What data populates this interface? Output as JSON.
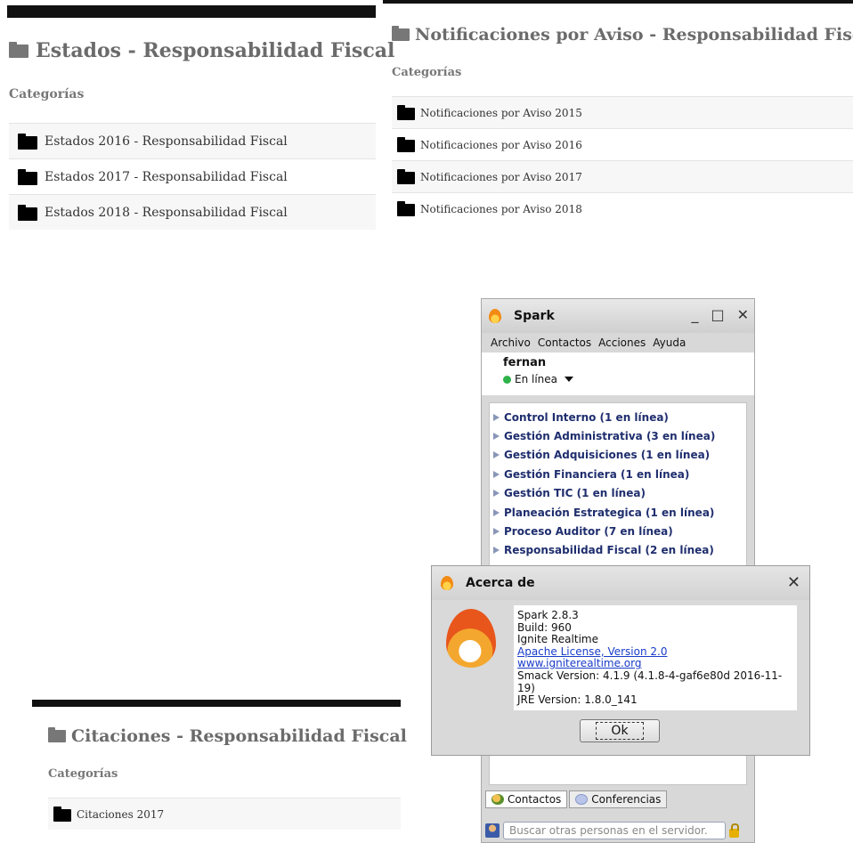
{
  "estados": {
    "title": "Estados - Responsabilidad Fiscal",
    "categories_label": "Categorías",
    "items": [
      "Estados 2016 - Responsabilidad Fiscal",
      "Estados 2017 - Responsabilidad Fiscal",
      "Estados 2018 - Responsabilidad Fiscal"
    ]
  },
  "notificaciones": {
    "title": "Notificaciones por Aviso - Responsabilidad Fiscal",
    "categories_label": "Categorías",
    "items": [
      "Notificaciones por Aviso 2015",
      "Notificaciones por Aviso 2016",
      "Notificaciones por Aviso 2017",
      "Notificaciones por Aviso 2018"
    ]
  },
  "citaciones": {
    "title": "Citaciones - Responsabilidad Fiscal",
    "categories_label": "Categorías",
    "items": [
      "Citaciones 2017"
    ]
  },
  "spark": {
    "title": "Spark",
    "window_buttons": {
      "minimize": "_",
      "maximize": "□",
      "close": "✕"
    },
    "menu": [
      "Archivo",
      "Contactos",
      "Acciones",
      "Ayuda"
    ],
    "username": "fernan",
    "status": "En línea",
    "groups": [
      "Control Interno (1 en línea)",
      "Gestión Administrativa (3 en línea)",
      "Gestión Adquisiciones (1 en línea)",
      "Gestión Financiera (1 en línea)",
      "Gestión TIC (1 en línea)",
      "Planeación Estrategica (1 en línea)",
      "Proceso Auditor (7 en línea)",
      "Responsabilidad Fiscal (2 en línea)"
    ],
    "tabs": [
      "Contactos",
      "Conferencias"
    ],
    "search_placeholder": "Buscar otras personas en el servidor."
  },
  "about": {
    "title": "Acerca de",
    "close": "✕",
    "lines": {
      "version": "Spark 2.8.3",
      "build": "Build: 960",
      "vendor": "Ignite Realtime",
      "license": "Apache License, Version 2.0",
      "site": "www.igniterealtime.org",
      "smack": "Smack Version: 4.1.9 (4.1.8-4-gaf6e80d 2016-11-19)",
      "jre": "JRE Version: 1.8.0_141"
    },
    "ok": "Ok"
  },
  "colors": {
    "link": "#1a3cc8",
    "group_text": "#1f2e6e",
    "online": "#2fb24a"
  }
}
